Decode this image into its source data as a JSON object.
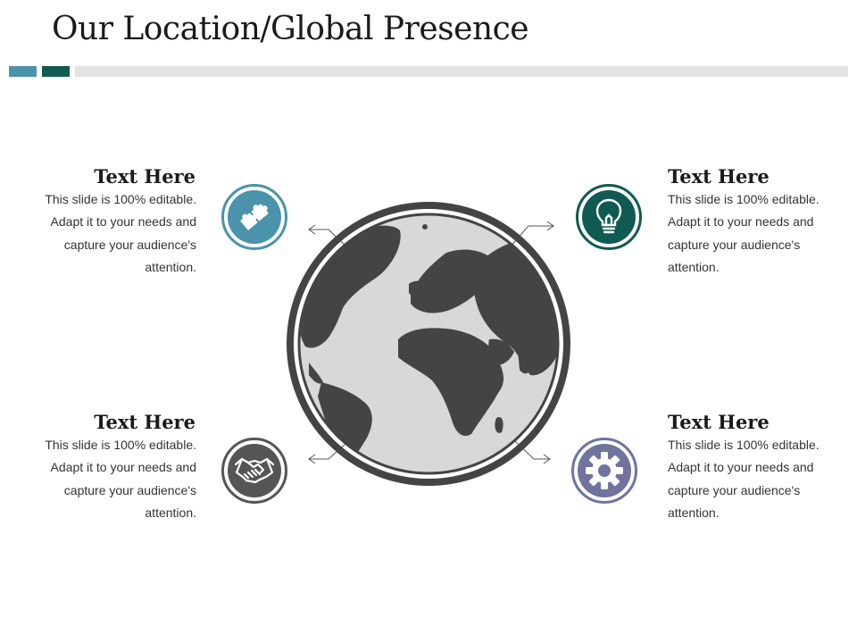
{
  "slide": {
    "title": "Our Location/Global Presence"
  },
  "colors": {
    "accent_teal": "#4a93aa",
    "accent_dark_teal": "#0f5a52",
    "accent_gray": "#555555",
    "accent_slate": "#6f739e",
    "divider_gray": "#e3e3e3",
    "globe_dark": "#444444",
    "globe_light": "#d8d8d8"
  },
  "items": [
    {
      "id": "top-left",
      "heading": "Text Here",
      "lines": [
        "This slide is 100% editable.",
        "Adapt it to your needs and",
        "capture your audience's",
        "attention."
      ],
      "icon": "puzzle-icon"
    },
    {
      "id": "top-right",
      "heading": "Text Here",
      "lines": [
        "This slide is 100% editable.",
        "Adapt it to your needs and",
        "capture your audience's",
        "attention."
      ],
      "icon": "lightbulb-icon"
    },
    {
      "id": "bottom-left",
      "heading": "Text Here",
      "lines": [
        "This slide is 100% editable.",
        "Adapt it to your needs and",
        "capture your audience's",
        "attention."
      ],
      "icon": "handshake-icon"
    },
    {
      "id": "bottom-right",
      "heading": "Text Here",
      "lines": [
        "This slide is 100% editable.",
        "Adapt it to your needs and",
        "capture your audience's",
        "attention."
      ],
      "icon": "gear-icon"
    }
  ],
  "center": {
    "icon": "globe-icon"
  }
}
